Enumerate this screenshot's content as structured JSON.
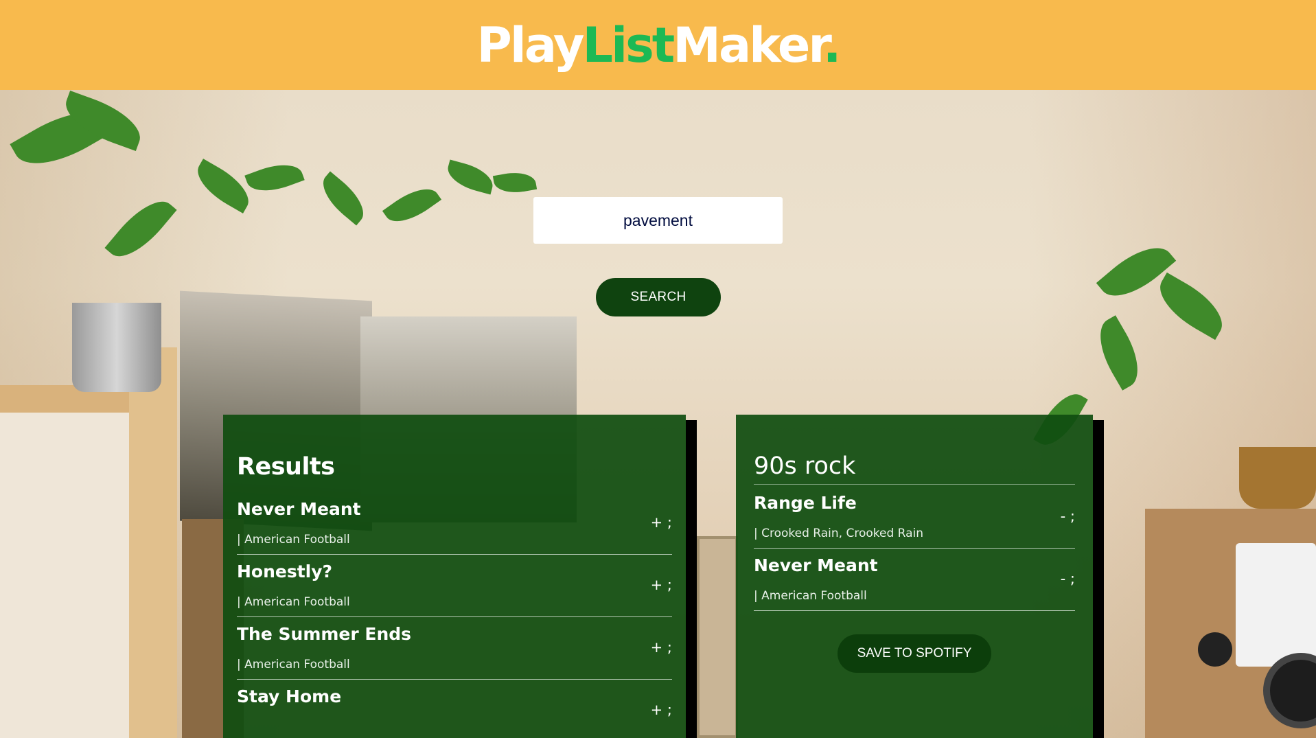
{
  "header": {
    "logo_part1": "Play",
    "logo_part2": "List",
    "logo_part3": "Maker",
    "logo_dot": ".",
    "background_color": "#f8ba4d",
    "accent_color": "#1db954"
  },
  "search": {
    "value": "pavement",
    "button_label": "SEARCH"
  },
  "results": {
    "title": "Results",
    "add_icon_text": "+ ;",
    "tracks": [
      {
        "name": "Never Meant",
        "meta": "| American Football"
      },
      {
        "name": "Honestly?",
        "meta": "| American Football"
      },
      {
        "name": "The Summer Ends",
        "meta": "| American Football"
      },
      {
        "name": "Stay Home",
        "meta": ""
      }
    ]
  },
  "playlist": {
    "name": "90s rock",
    "remove_icon_text": "- ;",
    "tracks": [
      {
        "name": "Range Life",
        "meta": "| Crooked Rain, Crooked Rain"
      },
      {
        "name": "Never Meant",
        "meta": "| American Football"
      }
    ],
    "save_label": "SAVE TO SPOTIFY"
  }
}
